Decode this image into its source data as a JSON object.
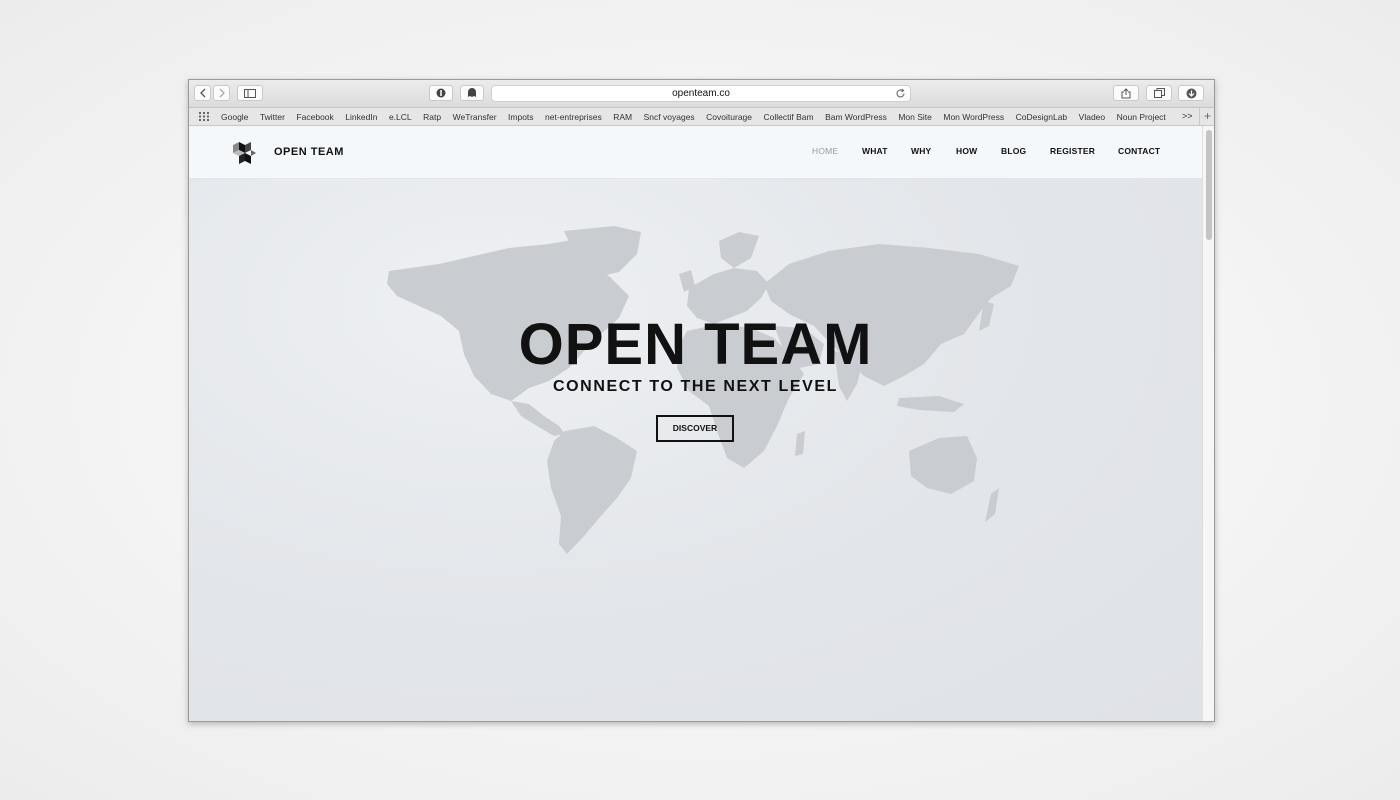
{
  "browser": {
    "url": "openteam.co",
    "bookmarks": [
      "Google",
      "Twitter",
      "Facebook",
      "LinkedIn",
      "e.LCL",
      "Ratp",
      "WeTransfer",
      "Impots",
      "net-entreprises",
      "RAM",
      "Sncf voyages",
      "Covoiturage",
      "Collectif Bam",
      "Bam WordPress",
      "Mon Site",
      "Mon WordPress",
      "CoDesignLab",
      "Vladeo",
      "Noun Project"
    ],
    "more_label": ">>",
    "add_label": "+"
  },
  "site": {
    "brand": "OPEN TEAM",
    "nav": [
      "HOME",
      "WHAT",
      "WHY",
      "HOW",
      "BLOG",
      "REGISTER",
      "CONTACT"
    ],
    "active_nav": "HOME",
    "hero": {
      "title": "OPEN TEAM",
      "subtitle": "CONNECT TO THE NEXT LEVEL",
      "cta": "DISCOVER"
    }
  },
  "colors": {
    "text": "#111111",
    "nav_active": "#999999",
    "header_bg": "#f5f8fb",
    "map": "#c9ccd1"
  }
}
